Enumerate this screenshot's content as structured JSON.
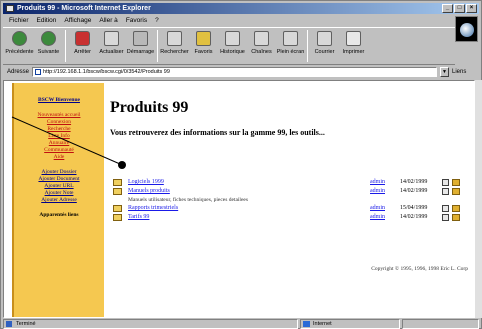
{
  "window": {
    "title": "Produits 99 - Microsoft Internet Explorer",
    "buttons": [
      "_",
      "□",
      "×"
    ]
  },
  "menu": [
    "Fichier",
    "Edition",
    "Affichage",
    "Aller à",
    "Favoris",
    "?"
  ],
  "toolbar": [
    {
      "label": "Précédente",
      "icon": "back-arrow-icon"
    },
    {
      "label": "Suivante",
      "icon": "forward-arrow-icon"
    },
    {
      "label": "Arrêter",
      "icon": "stop-icon"
    },
    {
      "label": "Actualiser",
      "icon": "refresh-icon"
    },
    {
      "label": "Démarrage",
      "icon": "home-icon"
    },
    {
      "label": "Rechercher",
      "icon": "search-icon"
    },
    {
      "label": "Favoris",
      "icon": "favorites-icon"
    },
    {
      "label": "Historique",
      "icon": "history-icon"
    },
    {
      "label": "Chaînes",
      "icon": "channels-icon"
    },
    {
      "label": "Plein écran",
      "icon": "fullscreen-icon"
    },
    {
      "label": "Courrier",
      "icon": "mail-icon"
    },
    {
      "label": "Imprimer",
      "icon": "print-icon"
    }
  ],
  "address": {
    "label": "Adresse",
    "value": "http://192.168.1.1/bscw/bscw.cgi/0/3542/Produits 99",
    "links_label": "Liens"
  },
  "sidebar": {
    "title": "BSCW Bienvenue",
    "group_a": [
      "Nouveautés accueil",
      "Connexion",
      "Recherche",
      "Liste Info",
      "Annuaire",
      "Communauté",
      "Aide"
    ],
    "group_b": [
      "Ajouter Dossier",
      "Ajouter Document",
      "Ajouter URL",
      "Ajouter Note",
      "Ajouter Adresse"
    ],
    "footer": "Apparentés liens"
  },
  "main": {
    "title": "Produits 99",
    "subtitle": "Vous retrouverez des informations sur la gamme 99, les outils...",
    "rows": [
      {
        "name": "Logiciels 1999",
        "user": "admin",
        "date": "14/02/1999",
        "desc": ""
      },
      {
        "name": "Manuels produits",
        "user": "admin",
        "date": "14/02/1999",
        "desc": "Manuels utilisateur, fiches techniques, pieces detailees"
      },
      {
        "name": "Rapports trimestriels",
        "user": "admin",
        "date": "15/04/1999",
        "desc": ""
      },
      {
        "name": "Tarifs 99",
        "user": "admin",
        "date": "14/02/1999",
        "desc": ""
      }
    ],
    "copyright": "Copyright © 1995, 1996, 1998 Eric L. Corp"
  },
  "status": {
    "left": "Terminé",
    "zone": "Internet"
  }
}
